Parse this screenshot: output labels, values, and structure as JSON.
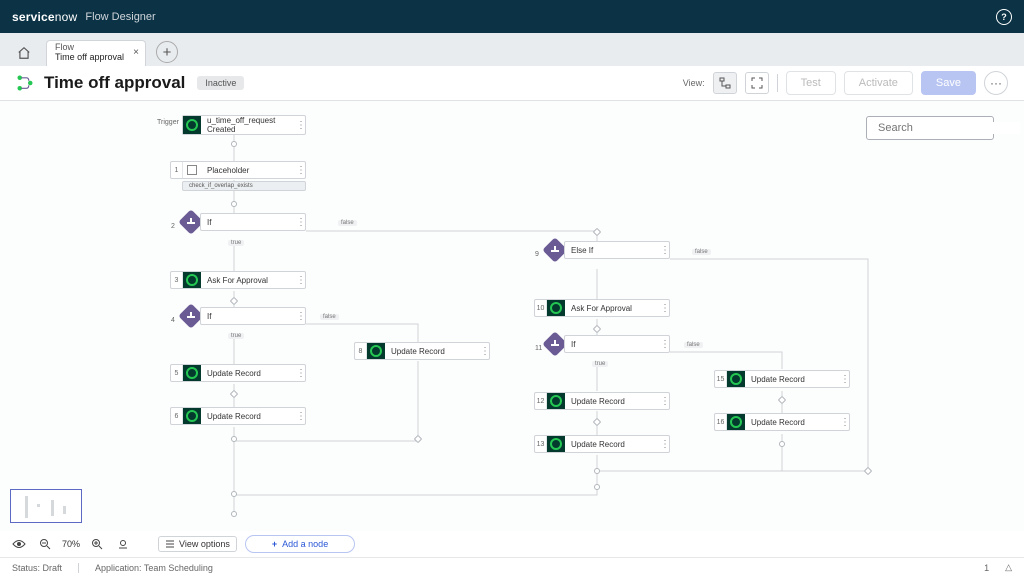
{
  "topbar": {
    "brand_prefix": "service",
    "brand_suffix": "now",
    "app_name": "Flow Designer",
    "help_glyph": "?"
  },
  "tabs": {
    "flow_type": "Flow",
    "flow_name": "Time off approval",
    "close_glyph": "×",
    "add_glyph": "+"
  },
  "header": {
    "title": "Time off approval",
    "status_pill": "Inactive",
    "view_label": "View:",
    "test_btn": "Test",
    "activate_btn": "Activate",
    "save_btn": "Save",
    "more_glyph": "···"
  },
  "search": {
    "placeholder": "Search"
  },
  "trigger": {
    "label": "Trigger",
    "line1": "u_time_off_request",
    "line2": "Created"
  },
  "subflow_chip": "check_if_overlap_exists",
  "nodes": {
    "n1": {
      "idx": "1",
      "label": "Placeholder"
    },
    "n2": {
      "idx": "2",
      "label": "If",
      "true_lbl": "true",
      "false_lbl": "false"
    },
    "n3": {
      "idx": "3",
      "label": "Ask For Approval"
    },
    "n4": {
      "idx": "4",
      "label": "If",
      "true_lbl": "true",
      "false_lbl": "false"
    },
    "n5": {
      "idx": "5",
      "label": "Update Record"
    },
    "n6": {
      "idx": "6",
      "label": "Update Record"
    },
    "n8": {
      "idx": "8",
      "label": "Update Record"
    },
    "n9": {
      "idx": "9",
      "label": "Else If",
      "false_lbl": "false"
    },
    "n10": {
      "idx": "10",
      "label": "Ask For Approval"
    },
    "n11": {
      "idx": "11",
      "label": "If",
      "true_lbl": "true",
      "false_lbl": "false"
    },
    "n12": {
      "idx": "12",
      "label": "Update Record"
    },
    "n13": {
      "idx": "13",
      "label": "Update Record"
    },
    "n15": {
      "idx": "15",
      "label": "Update Record"
    },
    "n16": {
      "idx": "16",
      "label": "Update Record"
    }
  },
  "bottom": {
    "zoom": "70%",
    "view_options": "View options",
    "add_node": "Add a node",
    "add_glyph": "+"
  },
  "status": {
    "status_text": "Status: Draft",
    "app_text": "Application: Team Scheduling",
    "count": "1",
    "warn_glyph": "△"
  }
}
